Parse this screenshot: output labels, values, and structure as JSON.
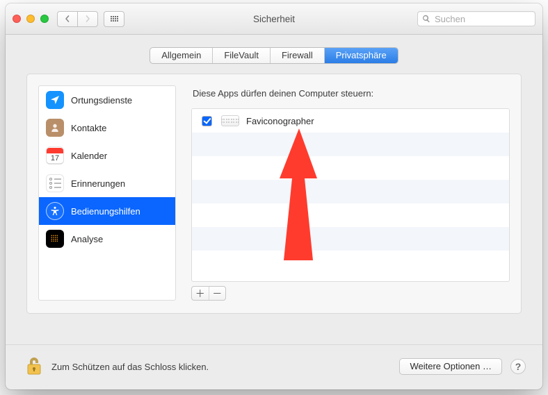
{
  "window": {
    "title": "Sicherheit"
  },
  "search": {
    "placeholder": "Suchen"
  },
  "tabs": [
    {
      "label": "Allgemein",
      "active": false
    },
    {
      "label": "FileVault",
      "active": false
    },
    {
      "label": "Firewall",
      "active": false
    },
    {
      "label": "Privatsphäre",
      "active": true
    }
  ],
  "sidebar": {
    "items": [
      {
        "label": "Ortungsdienste",
        "icon": "location-icon"
      },
      {
        "label": "Kontakte",
        "icon": "contacts-icon"
      },
      {
        "label": "Kalender",
        "icon": "calendar-icon",
        "calendar_day": "17"
      },
      {
        "label": "Erinnerungen",
        "icon": "reminders-icon"
      },
      {
        "label": "Bedienungshilfen",
        "icon": "accessibility-icon",
        "selected": true
      },
      {
        "label": "Analyse",
        "icon": "analytics-icon"
      }
    ]
  },
  "right": {
    "description": "Diese Apps dürfen deinen Computer steuern:",
    "apps": [
      {
        "name": "Faviconographer",
        "checked": true,
        "icon": "keyboard-app-icon"
      }
    ]
  },
  "footer": {
    "lock_text": "Zum Schützen auf das Schloss klicken.",
    "options_button": "Weitere Optionen …"
  },
  "annotation": {
    "arrow_color": "#ff3b2e"
  }
}
